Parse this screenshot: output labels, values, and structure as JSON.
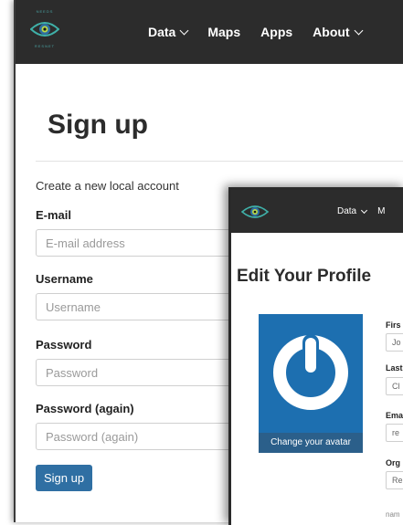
{
  "brand": {
    "top_text": "NEEDS",
    "bottom_text": "RESNET",
    "teal": "#3fb0a8",
    "blue": "#2f6fa3"
  },
  "nav": {
    "items": [
      {
        "label": "Data",
        "dropdown": true
      },
      {
        "label": "Maps",
        "dropdown": false
      },
      {
        "label": "Apps",
        "dropdown": false
      },
      {
        "label": "About",
        "dropdown": true
      }
    ]
  },
  "signup": {
    "title": "Sign up",
    "subtitle": "Create a new local account",
    "email_label": "E-mail",
    "email_placeholder": "E-mail address",
    "username_label": "Username",
    "username_placeholder": "Username",
    "password_label": "Password",
    "password_placeholder": "Password",
    "password2_label": "Password (again)",
    "password2_placeholder": "Password (again)",
    "submit_label": "Sign up"
  },
  "profile_window": {
    "nav_data": "Data",
    "nav_m": "M",
    "title": "Edit Your Profile",
    "avatar_caption": "Change your avatar",
    "first_label": "Firs",
    "first_value": "Jo",
    "last_label": "Last",
    "last_value": "Cl",
    "email_label": "Ema",
    "email_value": "re",
    "org_label": "Org",
    "org_value": "Re",
    "hint": "nam"
  }
}
